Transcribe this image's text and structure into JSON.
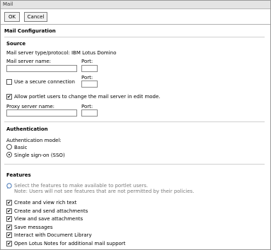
{
  "window": {
    "title": "Mail"
  },
  "toolbar": {
    "ok_label": "OK",
    "cancel_label": "Cancel"
  },
  "page": {
    "title": "Mail Configuration"
  },
  "source": {
    "heading": "Source",
    "server_type": "Mail server type/protocol: IBM Lotus Domino",
    "mail_server_label": "Mail server name:",
    "port_label": "Port:",
    "secure_label": "Use a secure connection",
    "secure_checked": false,
    "secure_port_label": "Port:",
    "allow_change_label": "Allow portlet users to change the mail server in edit mode.",
    "allow_change_checked": true,
    "proxy_label": "Proxy server name:",
    "proxy_port_label": "Port:"
  },
  "auth": {
    "heading": "Authentication",
    "model_label": "Authentication model:",
    "basic_label": "Basic",
    "sso_label": "Single sign-on (SSO)",
    "selected": "sso"
  },
  "features": {
    "heading": "Features",
    "help_line1": "Select the features to make available to portlet users.",
    "help_line2": "Note: Users will not see features that are not permitted by their policies.",
    "items": [
      {
        "label": "Create and view rich text",
        "checked": true
      },
      {
        "label": "Create and send attachments",
        "checked": true
      },
      {
        "label": "View and save attachments",
        "checked": true
      },
      {
        "label": "Save messages",
        "checked": true
      },
      {
        "label": "Interact with Document Library",
        "checked": true
      },
      {
        "label": "Open Lotus Notes for additional mail support",
        "checked": true
      }
    ]
  }
}
